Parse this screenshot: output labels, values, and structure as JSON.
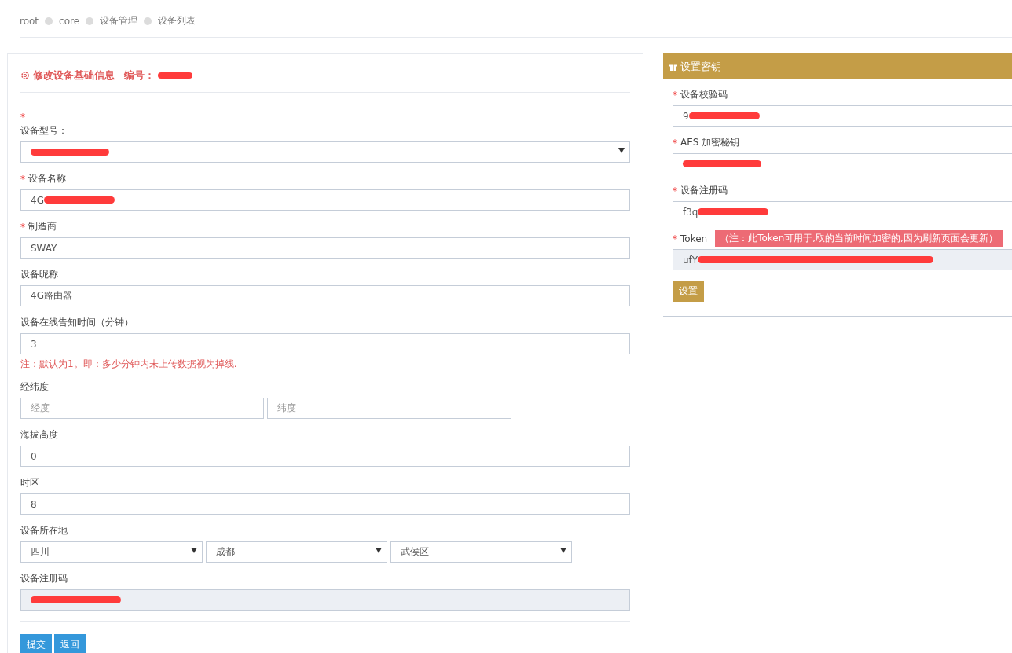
{
  "breadcrumb": [
    "root",
    "core",
    "设备管理",
    "设备列表"
  ],
  "edit_panel": {
    "title": "修改设备基础信息",
    "id_label": "编号：",
    "id_redacted": true,
    "fields": [
      {
        "kind": "select",
        "label": "设备型号：",
        "star": "*",
        "star_above": true,
        "redacted": true
      },
      {
        "kind": "input",
        "label": "设备名称",
        "star": "*",
        "star_above": false,
        "value": "4G",
        "redacted": true
      },
      {
        "kind": "input",
        "label": "制造商",
        "star": "*",
        "star_above": false,
        "value": "SWAY"
      },
      {
        "kind": "input",
        "label": "设备昵称",
        "value": "4G路由器"
      },
      {
        "kind": "input",
        "label": "设备在线告知时间（分钟）",
        "value": "3",
        "note": "注：默认为1。即：多少分钟内未上传数据视为掉线."
      },
      {
        "kind": "pair",
        "label": "经纬度",
        "placeholders": [
          "经度",
          "纬度"
        ]
      },
      {
        "kind": "input",
        "label": "海拔高度",
        "value": "0"
      },
      {
        "kind": "input",
        "label": "时区",
        "value": "8"
      },
      {
        "kind": "selects",
        "label": "设备所在地",
        "values": [
          "四川",
          "成都",
          "武侯区"
        ]
      },
      {
        "kind": "readonly",
        "label": "设备注册码",
        "redacted": true
      }
    ],
    "buttons": [
      "提交",
      "返回"
    ]
  },
  "key_panel": {
    "title": "设置密钥",
    "fields": [
      {
        "kind": "input",
        "label": "设备校验码",
        "star": "*",
        "star_above": false,
        "value": "9",
        "redacted": true
      },
      {
        "kind": "input",
        "label": "AES 加密秘钥",
        "star": "*",
        "star_above": false,
        "redacted": true
      },
      {
        "kind": "input",
        "label": "设备注册码",
        "star": "*",
        "star_above": false,
        "value": "f3q",
        "redacted": true
      },
      {
        "kind": "readonly",
        "label": "Token",
        "star": "*",
        "star_above": false,
        "value": "ufY",
        "redacted": true,
        "note": "（注：此Token可用于,取的当前时间加密的,因为刷新页面会更新）"
      }
    ],
    "button": "设置"
  }
}
